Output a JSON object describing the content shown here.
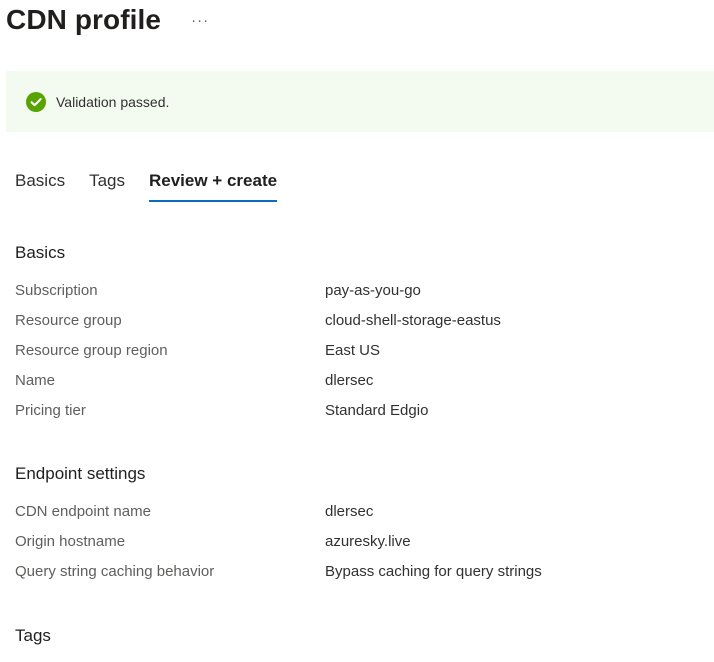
{
  "header": {
    "title": "CDN profile",
    "more": "···"
  },
  "banner": {
    "icon": "check-circle-icon",
    "color": "#57a300",
    "message": "Validation passed."
  },
  "tabs": [
    {
      "label": "Basics"
    },
    {
      "label": "Tags"
    },
    {
      "label": "Review + create",
      "active": true
    }
  ],
  "sections": {
    "basics": {
      "title": "Basics",
      "rows": [
        {
          "label": "Subscription",
          "value": "pay-as-you-go"
        },
        {
          "label": "Resource group",
          "value": "cloud-shell-storage-eastus"
        },
        {
          "label": "Resource group region",
          "value": "East US"
        },
        {
          "label": "Name",
          "value": "dlersec"
        },
        {
          "label": "Pricing tier",
          "value": "Standard Edgio"
        }
      ]
    },
    "endpoint": {
      "title": "Endpoint settings",
      "rows": [
        {
          "label": "CDN endpoint name",
          "value": "dlersec"
        },
        {
          "label": "Origin hostname",
          "value": "azuresky.live"
        },
        {
          "label": "Query string caching behavior",
          "value": "Bypass caching for query strings"
        }
      ]
    },
    "tags": {
      "title": "Tags"
    }
  }
}
